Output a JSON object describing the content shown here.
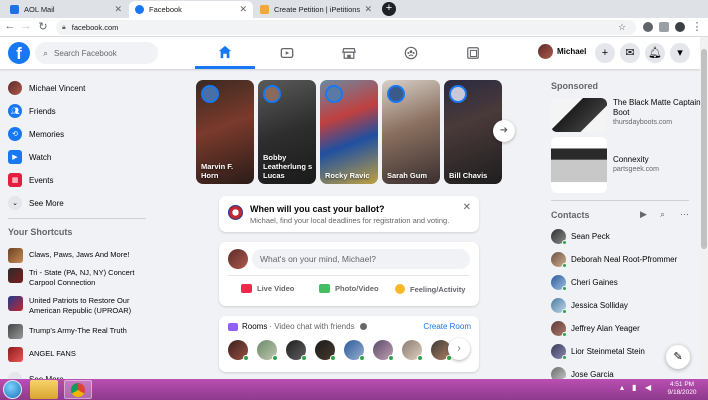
{
  "browser": {
    "tabs": [
      {
        "title": "AOL Mail",
        "favicon_color": "#1a73e8"
      },
      {
        "title": "Facebook",
        "favicon_color": "#1877f2"
      },
      {
        "title": "Create Petition | iPetitions",
        "favicon_color": "#f4a63b"
      }
    ],
    "url": "facebook.com"
  },
  "header": {
    "logo": "f",
    "search_placeholder": "Search Facebook",
    "nav_icons": [
      "home-icon",
      "watch-icon",
      "marketplace-icon",
      "groups-icon",
      "gaming-icon"
    ],
    "user_name": "Michael",
    "buttons": [
      "+",
      "messenger-icon",
      "notifications-icon",
      "account-menu-icon"
    ]
  },
  "left_sidebar": {
    "items": [
      {
        "label": "Michael Vincent",
        "icon": "avatar"
      },
      {
        "label": "Friends",
        "icon": "friends-icon"
      },
      {
        "label": "Memories",
        "icon": "memories-icon"
      },
      {
        "label": "Watch",
        "icon": "watch-icon"
      },
      {
        "label": "Events",
        "icon": "events-icon"
      },
      {
        "label": "See More",
        "icon": "chevron-down-icon"
      }
    ],
    "shortcuts_title": "Your Shortcuts",
    "shortcuts": [
      {
        "label": "Claws, Paws, Jaws And More!"
      },
      {
        "label": "Tri - State (PA, NJ, NY) Concert Carpool Connection"
      },
      {
        "label": "United Patriots to Restore Our American Republic (UPROAR)"
      },
      {
        "label": "Trump's Army-The Real Truth"
      },
      {
        "label": "ANGEL FANS"
      },
      {
        "label": "See More"
      }
    ]
  },
  "stories": [
    {
      "name": "Marvin F. Horn"
    },
    {
      "name": "Bobby Leatherlung s Lucas"
    },
    {
      "name": "Rocky Ravic"
    },
    {
      "name": "Sarah Gum"
    },
    {
      "name": "Bill Chavis"
    }
  ],
  "ballot": {
    "title": "When will you cast your ballot?",
    "text": "Michael, find your local deadlines for registration and voting."
  },
  "composer": {
    "placeholder": "What's on your mind, Michael?",
    "actions": [
      "Live Video",
      "Photo/Video",
      "Feeling/Activity"
    ]
  },
  "rooms": {
    "title": "Rooms",
    "subtitle": "· Video chat with friends",
    "create_label": "Create Room"
  },
  "right_sidebar": {
    "sponsored_title": "Sponsored",
    "ads": [
      {
        "title": "The Black Matte Captain Boot",
        "source": "thursdayboots.com"
      },
      {
        "title": "Connexity",
        "source": "partsgeek.com"
      }
    ],
    "contacts_title": "Contacts",
    "contacts": [
      {
        "name": "Sean Peck"
      },
      {
        "name": "Deborah Neal Root-Pfrommer"
      },
      {
        "name": "Cheri Gaines"
      },
      {
        "name": "Jessica Solliday"
      },
      {
        "name": "Jeffrey Alan Yeager"
      },
      {
        "name": "Lior Steinmetal Stein"
      },
      {
        "name": "Jose Garcia"
      }
    ]
  },
  "taskbar": {
    "time": "4:51 PM",
    "date": "9/18/2020"
  },
  "colors": {
    "fb_blue": "#1877f2",
    "taskbar": "#a94aa5",
    "online": "#31a24c"
  }
}
